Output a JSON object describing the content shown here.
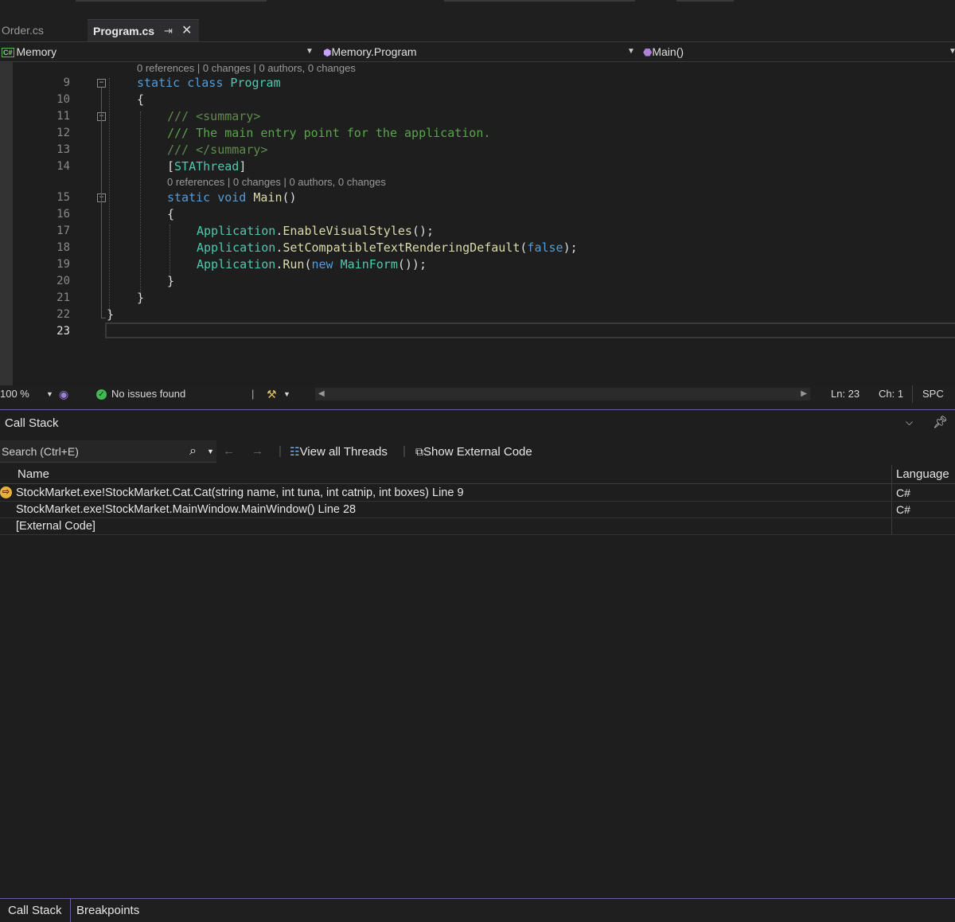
{
  "tabs": {
    "order": "Order.cs",
    "program": "Program.cs"
  },
  "navbar": {
    "project": "Memory",
    "project_badge": "C#",
    "klass": "Memory.Program",
    "member": "Main()"
  },
  "editor": {
    "lens1": "0 references | 0 changes | 0 authors, 0 changes",
    "lens2": "0 references | 0 changes | 0 authors, 0 changes",
    "line_numbers": [
      "9",
      "10",
      "11",
      "12",
      "13",
      "14",
      "15",
      "16",
      "17",
      "18",
      "19",
      "20",
      "21",
      "22",
      "23"
    ],
    "code": {
      "l9_kw": "static class",
      "l9_ty": "Program",
      "l10": "{",
      "l11_a": "/// ",
      "l11_b": "<summary>",
      "l12": "/// The main entry point for the application.",
      "l13_a": "/// ",
      "l13_b": "</summary>",
      "l14_a": "[",
      "l14_b": "STAThread",
      "l14_c": "]",
      "l15_kw": "static void",
      "l15_fn": "Main",
      "l15_p": "()",
      "l16": "{",
      "l17_ty": "Application",
      "l17_dot": ".",
      "l17_fn": "EnableVisualStyles",
      "l17_end": "();",
      "l18_ty": "Application",
      "l18_dot": ".",
      "l18_fn": "SetCompatibleTextRenderingDefault",
      "l18_o": "(",
      "l18_kw": "false",
      "l18_end": ");",
      "l19_ty": "Application",
      "l19_dot": ".",
      "l19_fn": "Run",
      "l19_o": "(",
      "l19_kw": "new",
      "l19_ty2": "MainForm",
      "l19_end": "());",
      "l20": "}",
      "l21": "}",
      "l22": "}"
    }
  },
  "status": {
    "zoom": "100 %",
    "issues": "No issues found",
    "ln": "Ln: 23",
    "ch": "Ch: 1",
    "spc": "SPC"
  },
  "callstack": {
    "title": "Call Stack",
    "search_placeholder": "Search (Ctrl+E)",
    "view_threads": "View all Threads",
    "show_external": "Show External Code",
    "col_name": "Name",
    "col_language": "Language",
    "rows": [
      {
        "name": "StockMarket.exe!StockMarket.Cat.Cat(string name, int tuna, int catnip, int boxes) Line 9",
        "language": "C#"
      },
      {
        "name": "StockMarket.exe!StockMarket.MainWindow.MainWindow() Line 28",
        "language": "C#"
      },
      {
        "name": "[External Code]",
        "language": ""
      }
    ]
  },
  "bottom_tabs": {
    "callstack": "Call Stack",
    "breakpoints": "Breakpoints"
  }
}
